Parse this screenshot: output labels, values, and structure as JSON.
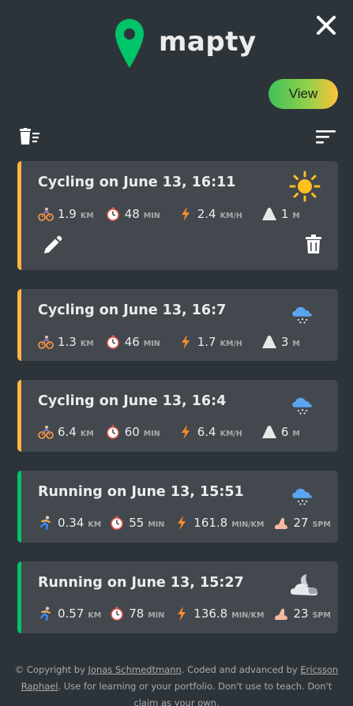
{
  "app": {
    "name": "mapty"
  },
  "header": {
    "view_label": "View"
  },
  "workouts": [
    {
      "type": "cycling",
      "title": "Cycling on June 13, 16:11",
      "weather_icon": "sun-icon",
      "stats": [
        {
          "icon": "cyclist-icon",
          "value": "1.9",
          "unit": "KM"
        },
        {
          "icon": "stopwatch-icon",
          "value": "48",
          "unit": "MIN"
        },
        {
          "icon": "lightning-icon",
          "value": "2.4",
          "unit": "KM/H"
        },
        {
          "icon": "mountain-icon",
          "value": "1",
          "unit": "M"
        }
      ],
      "expanded": true
    },
    {
      "type": "cycling",
      "title": "Cycling on June 13, 16:7",
      "weather_icon": "snow-cloud-icon",
      "stats": [
        {
          "icon": "cyclist-icon",
          "value": "1.3",
          "unit": "KM"
        },
        {
          "icon": "stopwatch-icon",
          "value": "46",
          "unit": "MIN"
        },
        {
          "icon": "lightning-icon",
          "value": "1.7",
          "unit": "KM/H"
        },
        {
          "icon": "mountain-icon",
          "value": "3",
          "unit": "M"
        }
      ]
    },
    {
      "type": "cycling",
      "title": "Cycling on June 13, 16:4",
      "weather_icon": "snow-cloud-icon",
      "stats": [
        {
          "icon": "cyclist-icon",
          "value": "6.4",
          "unit": "KM"
        },
        {
          "icon": "stopwatch-icon",
          "value": "60",
          "unit": "MIN"
        },
        {
          "icon": "lightning-icon",
          "value": "6.4",
          "unit": "KM/H"
        },
        {
          "icon": "mountain-icon",
          "value": "6",
          "unit": "M"
        }
      ]
    },
    {
      "type": "running",
      "title": "Running on June 13, 15:51",
      "weather_icon": "snow-cloud-icon",
      "stats": [
        {
          "icon": "runner-icon",
          "value": "0.34",
          "unit": "KM"
        },
        {
          "icon": "stopwatch-icon",
          "value": "55",
          "unit": "MIN"
        },
        {
          "icon": "lightning-icon",
          "value": "161.8",
          "unit": "MIN/KM"
        },
        {
          "icon": "footprint-icon",
          "value": "27",
          "unit": "SPM"
        }
      ]
    },
    {
      "type": "running",
      "title": "Running on June 13, 15:27",
      "weather_icon": "cloudy-night-icon",
      "stats": [
        {
          "icon": "runner-icon",
          "value": "0.57",
          "unit": "KM"
        },
        {
          "icon": "stopwatch-icon",
          "value": "78",
          "unit": "MIN"
        },
        {
          "icon": "lightning-icon",
          "value": "136.8",
          "unit": "MIN/KM"
        },
        {
          "icon": "footprint-icon",
          "value": "23",
          "unit": "SPM"
        }
      ]
    }
  ],
  "footer": {
    "prefix": "© Copyright by ",
    "author": "Jonas Schmedtmann",
    "middle": ". Coded and advanced by ",
    "contributor": "Ericsson Raphael",
    "suffix": ". Use for learning or your portfolio. Don't use to teach. Don't claim as your own."
  },
  "colors": {
    "background": "#2d3439",
    "card": "#42484d",
    "cycling_accent": "#ffb545",
    "running_accent": "#00c46a",
    "logo_green": "#00c46a"
  }
}
